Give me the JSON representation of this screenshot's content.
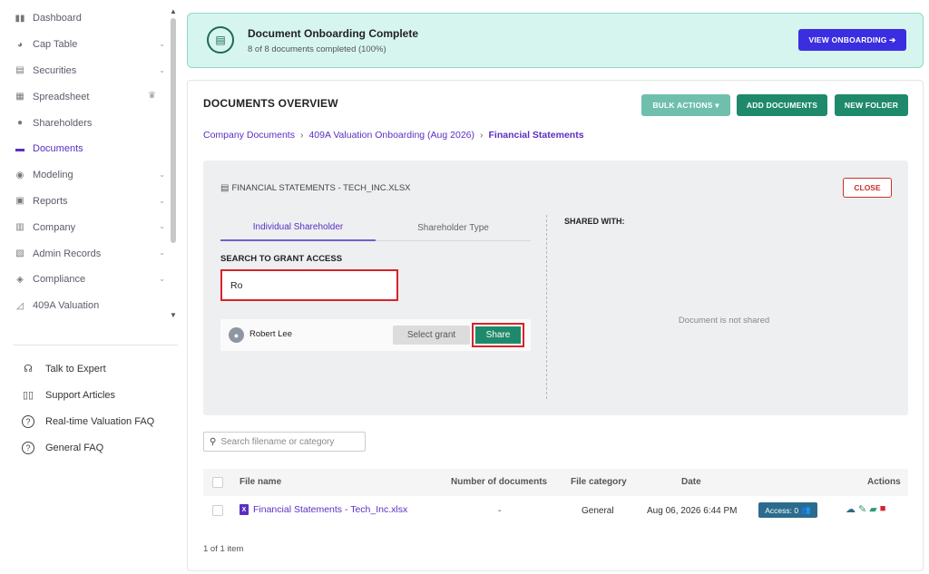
{
  "sidebar": {
    "items": [
      {
        "label": "Dashboard",
        "icon": "dashboard-icon",
        "glyph": "▮▮",
        "chevron": false
      },
      {
        "label": "Cap Table",
        "icon": "pie-chart-icon",
        "glyph": "◕",
        "chevron": true
      },
      {
        "label": "Securities",
        "icon": "clipboard-icon",
        "glyph": "▤",
        "chevron": true
      },
      {
        "label": "Spreadsheet",
        "icon": "table-icon",
        "glyph": "▦",
        "chevron": false,
        "crown": true
      },
      {
        "label": "Shareholders",
        "icon": "user-icon",
        "glyph": "●",
        "chevron": false
      },
      {
        "label": "Documents",
        "icon": "folder-icon",
        "glyph": "▬",
        "chevron": false,
        "active": true
      },
      {
        "label": "Modeling",
        "icon": "lightbulb-icon",
        "glyph": "◉",
        "chevron": true
      },
      {
        "label": "Reports",
        "icon": "report-icon",
        "glyph": "▣",
        "chevron": true
      },
      {
        "label": "Company",
        "icon": "building-icon",
        "glyph": "▥",
        "chevron": true
      },
      {
        "label": "Admin Records",
        "icon": "records-icon",
        "glyph": "▧",
        "chevron": true
      },
      {
        "label": "Compliance",
        "icon": "shield-check-icon",
        "glyph": "◈",
        "chevron": true
      },
      {
        "label": "409A Valuation",
        "icon": "valuation-icon",
        "glyph": "◿",
        "chevron": false
      }
    ],
    "help_items": [
      {
        "label": "Talk to Expert",
        "icon": "headset-icon",
        "glyph": "☊"
      },
      {
        "label": "Support Articles",
        "icon": "book-icon",
        "glyph": "▯▯"
      },
      {
        "label": "Real-time Valuation FAQ",
        "icon": "question-circle-icon",
        "glyph": "?"
      },
      {
        "label": "General FAQ",
        "icon": "question-circle-icon",
        "glyph": "?"
      }
    ]
  },
  "banner": {
    "title": "Document Onboarding Complete",
    "subtitle": "8 of 8 documents completed (100%)",
    "button_label": "VIEW ONBOARDING ➔"
  },
  "overview": {
    "title": "DOCUMENTS OVERVIEW",
    "bulk_actions_label": "BULK ACTIONS ▾",
    "add_documents_label": "ADD DOCUMENTS",
    "new_folder_label": "NEW FOLDER",
    "breadcrumb": {
      "items": [
        "Company Documents",
        "409A Valuation Onboarding (Aug 2026)",
        "Financial Statements"
      ],
      "separator": "›"
    }
  },
  "share_panel": {
    "file_title": "FINANCIAL STATEMENTS - TECH_INC.XLSX",
    "close_label": "CLOSE",
    "tabs": [
      "Individual Shareholder",
      "Shareholder Type"
    ],
    "search_label": "SEARCH TO GRANT ACCESS",
    "search_value": "Ro",
    "result": {
      "name": "Robert Lee",
      "select_grant_label": "Select grant",
      "share_label": "Share"
    },
    "shared_with_label": "SHARED WITH:",
    "not_shared_text": "Document is not shared"
  },
  "files": {
    "search_placeholder": "Search filename or category",
    "columns": {
      "name": "File name",
      "count": "Number of documents",
      "category": "File category",
      "date": "Date",
      "actions": "Actions"
    },
    "rows": [
      {
        "name": "Financial Statements - Tech_Inc.xlsx",
        "count": "-",
        "category": "General",
        "date": "Aug 06, 2026 6:44 PM",
        "access": "Access: 0"
      }
    ],
    "pagination": "1 of 1 item"
  },
  "colors": {
    "brand_purple": "#5b2fc0",
    "primary_green": "#1f8a6b",
    "view_button_blue": "#3b2ee0",
    "highlight_red": "#d8222a",
    "banner_bg": "#d6f5ee"
  }
}
